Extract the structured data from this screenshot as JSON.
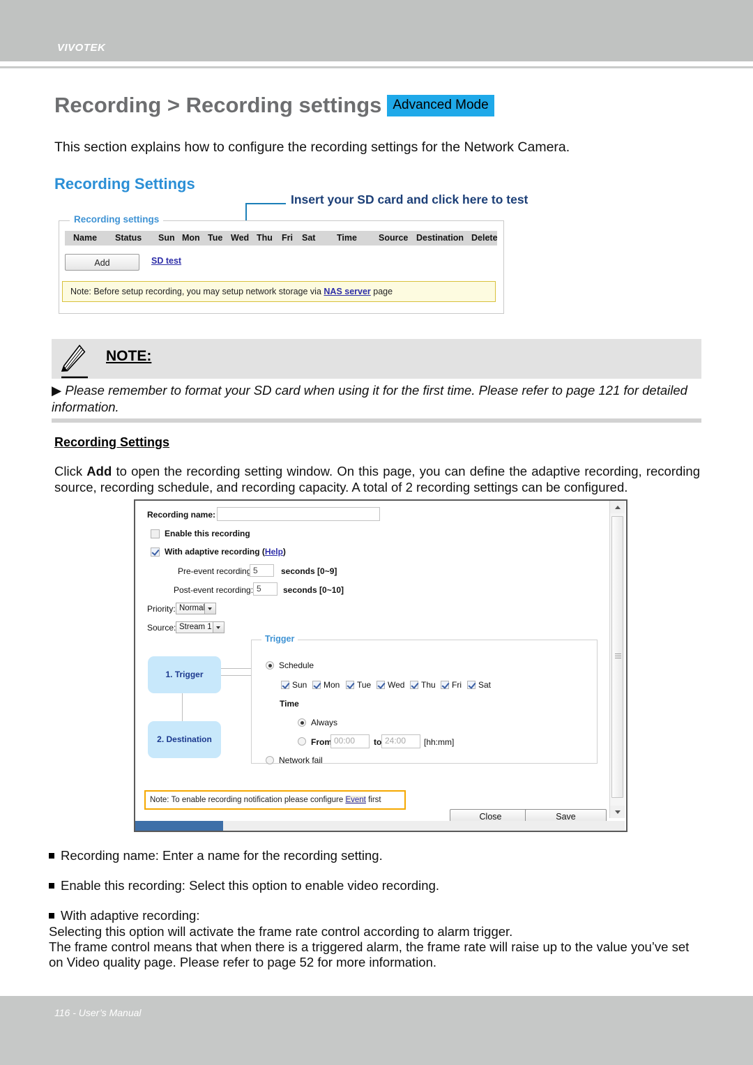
{
  "header": {
    "brand": "VIVOTEK"
  },
  "page": {
    "title": "Recording > Recording settings",
    "mode_badge": "Advanced Mode",
    "intro": "This section explains how to configure the recording settings for the Network Camera.",
    "section_heading": "Recording Settings",
    "callout": "Insert your SD card and click here to test"
  },
  "recording_settings_panel": {
    "legend": "Recording settings",
    "columns": [
      "Name",
      "Status",
      "Sun",
      "Mon",
      "Tue",
      "Wed",
      "Thu",
      "Fri",
      "Sat",
      "Time",
      "Source",
      "Destination",
      "Delete"
    ],
    "add_button": "Add",
    "sd_test_link": "SD test",
    "note_prefix": "Note: Before setup recording, you may setup network storage via ",
    "note_link": "NAS server",
    "note_suffix": " page"
  },
  "note_block": {
    "title": "NOTE:",
    "arrow": "▶",
    "body": "Please remember to format your SD card when using it for the first time. Please refer to page 121 for detailed information."
  },
  "body": {
    "sub_heading": "Recording Settings",
    "paragraph_pre": "Click ",
    "paragraph_bold": "Add",
    "paragraph_post": " to open the recording setting window. On this page, you can define the adaptive recording, recording source, recording schedule, and recording capacity. A total of 2 recording settings can be configured."
  },
  "dialog": {
    "recording_name_label": "Recording name:",
    "recording_name_value": "",
    "enable_label": "Enable this recording",
    "enable_checked": false,
    "adaptive_label": "With adaptive recording (",
    "adaptive_help": "Help",
    "adaptive_label_end": ")",
    "adaptive_checked": true,
    "pre_event_label": "Pre-event recording:",
    "pre_event_value": "5",
    "pre_event_units": "seconds [0~9]",
    "post_event_label": "Post-event recording:",
    "post_event_value": "5",
    "post_event_units": "seconds [0~10]",
    "priority_label": "Priority:",
    "priority_value": "Normal",
    "source_label": "Source:",
    "source_value": "Stream 1",
    "flow_step1": "1. Trigger",
    "flow_step2": "2. Destination",
    "trigger": {
      "legend": "Trigger",
      "schedule_label": "Schedule",
      "schedule_selected": true,
      "days": [
        {
          "label": "Sun",
          "checked": true
        },
        {
          "label": "Mon",
          "checked": true
        },
        {
          "label": "Tue",
          "checked": true
        },
        {
          "label": "Wed",
          "checked": true
        },
        {
          "label": "Thu",
          "checked": true
        },
        {
          "label": "Fri",
          "checked": true
        },
        {
          "label": "Sat",
          "checked": true
        }
      ],
      "time_label": "Time",
      "always_label": "Always",
      "always_selected": true,
      "from_label": "From",
      "from_value": "00:00",
      "to_label": "to",
      "to_value": "24:00",
      "time_format": "[hh:mm]",
      "network_fail_label": "Network fail",
      "network_fail_selected": false
    },
    "note_prefix": "Note: To enable recording notification please configure ",
    "note_link": "Event",
    "note_suffix": " first",
    "close_button": "Close",
    "save_button": "Save"
  },
  "bullets": [
    "Recording name: Enter a name for the recording setting.",
    "Enable this recording: Select this option to enable video recording.",
    "With adaptive recording:"
  ],
  "bullet_extra": [
    "Selecting this option will activate the frame rate control according to alarm trigger.",
    "The frame control means that when there is a triggered alarm, the frame rate will raise up to the value you’ve set on Video quality page. Please refer to page 52 for more information."
  ],
  "footer": {
    "text": "116 - User’s Manual"
  },
  "colors": {
    "header_gray": "#c0c2c1",
    "accent_blue": "#2b8fd6",
    "badge_blue": "#1fa9e9",
    "callout_navy": "#1c3f77",
    "link_blue": "#2e2ea8",
    "flow_box_blue": "#c8e8fb",
    "warn_orange": "#f5a800",
    "note_yellow_bg": "#fdfbe0"
  }
}
